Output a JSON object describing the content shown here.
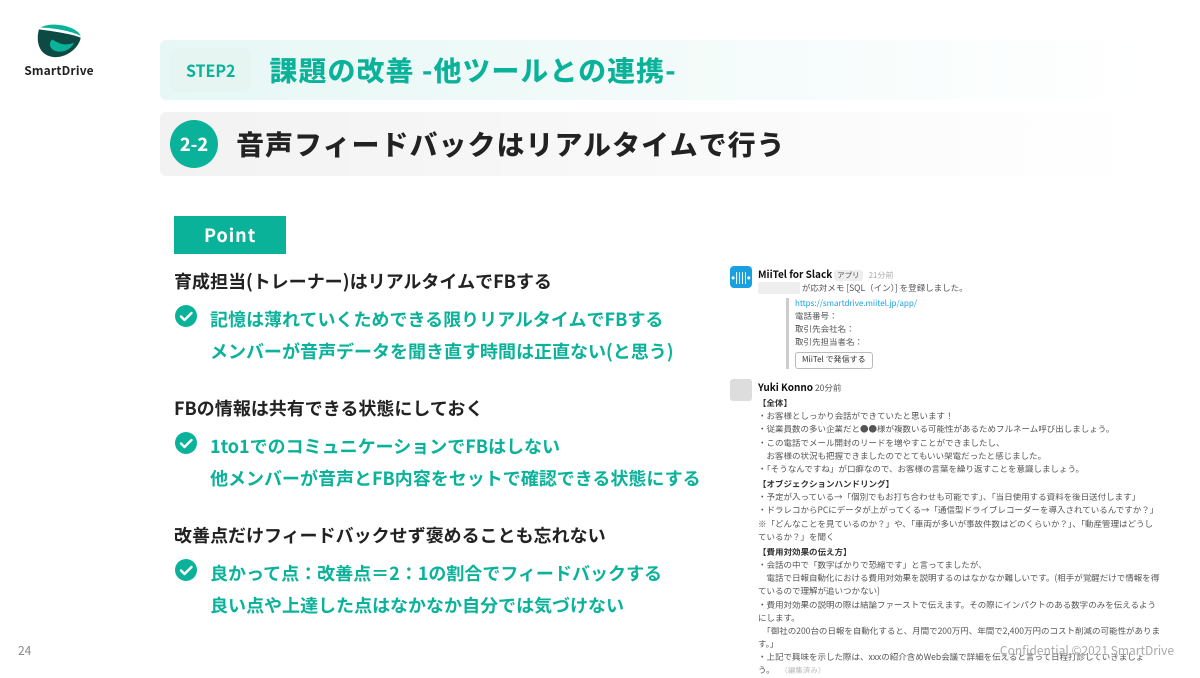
{
  "brand": {
    "name": "SmartDrive"
  },
  "header": {
    "step_label": "STEP2",
    "title": "課題の改善 -他ツールとの連携-",
    "section_no": "2-2",
    "subtitle": "音声フィードバックはリアルタイムで行う"
  },
  "point_label": "Point",
  "blocks": [
    {
      "lead": "育成担当(トレーナー)はリアルタイムでFBする",
      "lines": [
        "記憶は薄れていくためできる限りリアルタイムでFBする",
        "メンバーが音声データを聞き直す時間は正直ない(と思う)"
      ]
    },
    {
      "lead": "FBの情報は共有できる状態にしておく",
      "lines": [
        "1to1でのコミュニケーションでFBはしない",
        "他メンバーが音声とFB内容をセットで確認できる状態にする"
      ]
    },
    {
      "lead": "改善点だけフィードバックせず褒めることも忘れない",
      "lines": [
        "良かって点：改善点＝2：1の割合でフィードバックする",
        "良い点や上達した点はなかなか自分では気づけない"
      ]
    }
  ],
  "mock": {
    "app_name": "MiiTel for Slack",
    "app_tag": "アプリ",
    "app_time": "21分前",
    "notice": "が応対メモ [SQL（イン）] を登録しました。",
    "url": "https://smartdrive.miitel.jp/app/",
    "fields": [
      "電話番号：",
      "取引先会社名：",
      "取引先担当者名："
    ],
    "button": "MiiTel で発信する",
    "user": "Yuki Konno",
    "user_time": "20分前",
    "sections": [
      {
        "title": "【全体】",
        "items": [
          "・お客様としっかり会話ができていたと思います！",
          "・従業員数の多い企業だと●●様が複数いる可能性があるためフルネーム呼び出しましょう。",
          "・この電話でメール開封のリードを増やすことができましたし、",
          "　お客様の状況も把握できましたのでとてもいい架電だったと感じました。",
          "・「そうなんですね」が口癖なので、お客様の言葉を繰り返すことを意識しましょう。"
        ]
      },
      {
        "title": "【オブジェクションハンドリング】",
        "items": [
          "・予定が入っている→「個別でもお打ち合わせも可能です」、「当日使用する資料を後日送付します」",
          "・ドラレコからPCにデータが上がってくる→「通信型ドライブレコーダーを導入されているんですか？」",
          "※「どんなことを見ているのか？」や、「車両が多いが事故件数はどのくらいか？」、「動産管理はどうしているか？」を聞く"
        ]
      },
      {
        "title": "【費用対効果の伝え方】",
        "items": [
          "・会話の中で「数字ばかりで恐縮です」と言ってましたが、",
          "　電話で日報自動化における費用対効果を説明するのはなかなか難しいです。(相手が覚醒だけで情報を得ているので理解が追いつかない)",
          "・費用対効果の説明の際は結論ファーストで伝えます。その際にインパクトのある数字のみを伝えるようにします。",
          "　「御社の200台の日報を自動化すると、月間で200万円、年間で2,400万円のコスト削減の可能性があります。」",
          "・上記で興味を示した際は、xxxの紹介含めWeb会議で詳細を伝えると言って日程打診していきましょう。"
        ]
      }
    ],
    "edited": "（編集済み）"
  },
  "footer": {
    "page": "24",
    "copyright": "Confidential  ©2021 SmartDrive"
  }
}
